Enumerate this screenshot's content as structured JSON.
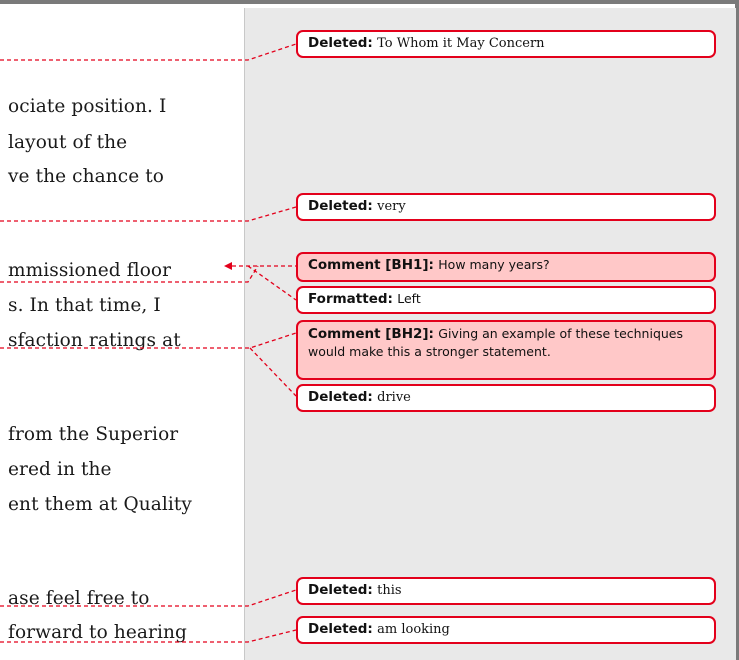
{
  "document": {
    "lines": [
      "ociate position. I",
      "layout of the",
      "ve the chance to",
      "mmissioned floor",
      "s.  In that time, I",
      "sfaction ratings at",
      "from the Superior",
      "ered in the",
      "ent them at Quality",
      "ase feel free to",
      "forward to hearing"
    ]
  },
  "balloons": [
    {
      "kind": "Deleted:",
      "text": "To Whom it May Concern"
    },
    {
      "kind": "Deleted:",
      "text": "very"
    },
    {
      "kind": "Comment [BH1]:",
      "text": "How many years?"
    },
    {
      "kind": "Formatted:",
      "text": "Left"
    },
    {
      "kind": "Comment [BH2]:",
      "text": "Giving an example of these techniques would make this a stronger statement."
    },
    {
      "kind": "Deleted:",
      "text": "drive"
    },
    {
      "kind": "Deleted:",
      "text": "this"
    },
    {
      "kind": "Deleted:",
      "text": "am looking"
    }
  ],
  "colors": {
    "markup_line": "#e3001b",
    "comment_fill": "#ffc8c8",
    "pane_background": "#e9e9e9",
    "frame": "#7a7a7a"
  },
  "icons": {
    "anchor": "arrow-left-icon"
  }
}
